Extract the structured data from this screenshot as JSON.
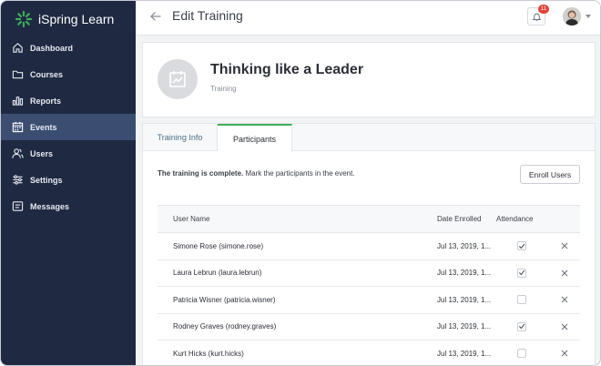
{
  "app": {
    "brand": "iSpring Learn",
    "accent": "#3fae5a",
    "sidebar_bg": "#1f2942"
  },
  "sidebar": {
    "items": [
      {
        "label": "Dashboard",
        "icon": "home-icon",
        "active": false
      },
      {
        "label": "Courses",
        "icon": "folder-icon",
        "active": false
      },
      {
        "label": "Reports",
        "icon": "bar-chart-icon",
        "active": false
      },
      {
        "label": "Events",
        "icon": "calendar-icon",
        "active": true
      },
      {
        "label": "Users",
        "icon": "users-icon",
        "active": false
      },
      {
        "label": "Settings",
        "icon": "sliders-icon",
        "active": false
      },
      {
        "label": "Messages",
        "icon": "message-icon",
        "active": false
      }
    ]
  },
  "topbar": {
    "title": "Edit Training",
    "notifications_count": "11"
  },
  "header": {
    "title": "Thinking like a Leader",
    "type": "Training"
  },
  "tabs": [
    {
      "label": "Training Info",
      "active": false
    },
    {
      "label": "Participants",
      "active": true
    }
  ],
  "participants": {
    "status_bold": "The training is complete.",
    "status_rest": " Mark the participants in the event.",
    "enroll_button": "Enroll Users",
    "columns": {
      "name": "User Name",
      "date": "Date Enrolled",
      "attendance": "Attendance"
    },
    "rows": [
      {
        "name": "Simone Rose (simone.rose)",
        "date": "Jul 13, 2019, 1...",
        "attended": true
      },
      {
        "name": "Laura Lebrun (laura.lebrun)",
        "date": "Jul 13, 2019, 1...",
        "attended": true
      },
      {
        "name": "Patricia Wisner (patricia.wisner)",
        "date": "Jul 13, 2019, 1...",
        "attended": false
      },
      {
        "name": "Rodney Graves (rodney.graves)",
        "date": "Jul 13, 2019, 1...",
        "attended": true
      },
      {
        "name": "Kurt Hicks (kurt.hicks)",
        "date": "Jul 13, 2019, 1...",
        "attended": false
      }
    ]
  }
}
